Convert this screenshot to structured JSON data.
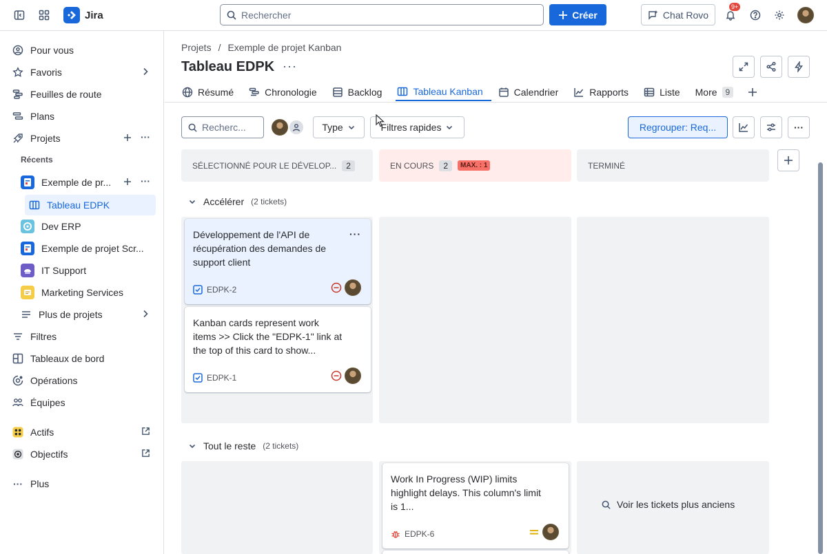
{
  "app": {
    "name": "Jira"
  },
  "topbar": {
    "search_placeholder": "Rechercher",
    "create_label": "Créer",
    "chat_label": "Chat Rovo",
    "notif_count": "9+",
    "icons": [
      "sidebar-toggle-icon",
      "app-switcher-icon",
      "bell-icon",
      "help-icon",
      "gear-icon"
    ]
  },
  "sidebar": {
    "items": [
      {
        "label": "Pour vous",
        "icon": "person-circle-icon"
      },
      {
        "label": "Favoris",
        "icon": "star-icon"
      },
      {
        "label": "Feuilles de route",
        "icon": "roadmap-icon"
      },
      {
        "label": "Plans",
        "icon": "plans-icon"
      },
      {
        "label": "Projets",
        "icon": "rocket-icon"
      }
    ],
    "recents_label": "Récents",
    "recent_projects": [
      {
        "label": "Exemple de pr...",
        "color": "#1868db"
      },
      {
        "label": "Tableau EDPK"
      },
      {
        "label": "Dev ERP",
        "color": "#6cc3e0"
      },
      {
        "label": "Exemple de projet Scr...",
        "color": "#1868db"
      },
      {
        "label": "IT Support",
        "color": "#6e5dc6"
      },
      {
        "label": "Marketing Services",
        "color": "#f5cd47"
      },
      {
        "label": "Plus de projets"
      }
    ],
    "bottom_items": [
      {
        "label": "Filtres"
      },
      {
        "label": "Tableaux de bord"
      },
      {
        "label": "Opérations"
      },
      {
        "label": "Équipes"
      },
      {
        "label": "Actifs"
      },
      {
        "label": "Objectifs"
      },
      {
        "label": "Plus"
      }
    ]
  },
  "header": {
    "breadcrumb": [
      "Projets",
      "/",
      "Exemple de projet Kanban"
    ],
    "title": "Tableau EDPK",
    "title_more": "···"
  },
  "tabs": [
    {
      "label": "Résumé",
      "icon": "globe-icon"
    },
    {
      "label": "Chronologie",
      "icon": "timeline-icon"
    },
    {
      "label": "Backlog",
      "icon": "backlog-icon"
    },
    {
      "label": "Tableau Kanban",
      "icon": "board-icon",
      "active": true
    },
    {
      "label": "Calendrier",
      "icon": "calendar-icon"
    },
    {
      "label": "Rapports",
      "icon": "chart-line-icon"
    },
    {
      "label": "Liste",
      "icon": "list-icon"
    }
  ],
  "tabs_more": {
    "label": "More",
    "count": "9"
  },
  "toolbar": {
    "search_placeholder": "Recherc...",
    "type_label": "Type",
    "quick_filters_label": "Filtres rapides",
    "group_label": "Regrouper: Req..."
  },
  "columns": [
    {
      "title": "SÉLECTIONNÉ POUR LE DÉVELOP...",
      "count": "2"
    },
    {
      "title": "EN COURS",
      "count": "2",
      "max": "MAX. : 1"
    },
    {
      "title": "TERMINÉ"
    }
  ],
  "swimlanes": [
    {
      "title": "Accélérer",
      "count_text": "(2 tickets)"
    },
    {
      "title": "Tout le reste",
      "count_text": "(2 tickets)"
    }
  ],
  "cards": [
    {
      "summary": "Développement de l'API de récupération des demandes de support client",
      "key": "EDPK-2",
      "type": "task",
      "priority": "blocker",
      "more": "···"
    },
    {
      "summary": "Kanban cards represent work items >> Click the \"EDPK-1\" link at the top of this card to show...",
      "key": "EDPK-1",
      "type": "task",
      "priority": "blocker"
    },
    {
      "summary": "Work In Progress (WIP) limits highlight delays. This column's limit is 1...",
      "key": "EDPK-6",
      "type": "bug",
      "priority": "medium"
    }
  ],
  "older_link": "Voir les tickets plus anciens",
  "colors": {
    "accent": "#1868db",
    "active_bg": "#e9f2fe",
    "lane_bg": "#f1f2f4",
    "wip_bg": "#ffeceb",
    "wip_pill": "#f87168",
    "blocker": "#c9372c",
    "bug": "#e2483d",
    "medium": "#e2b203"
  }
}
